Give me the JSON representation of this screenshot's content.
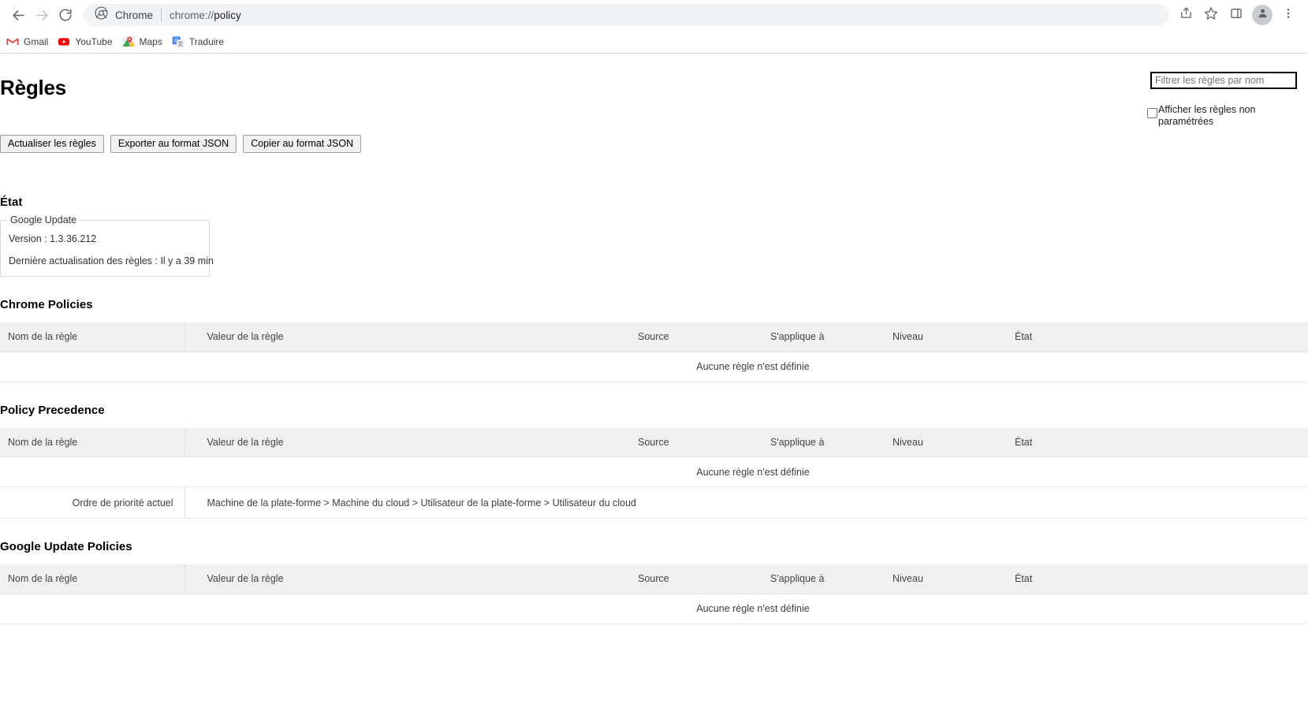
{
  "browser": {
    "back_icon": "back-arrow-icon",
    "forward_icon": "forward-arrow-icon",
    "reload_icon": "reload-icon",
    "omnibox": {
      "chrome_label": "Chrome",
      "url_scheme": "chrome://",
      "url_path": "policy"
    },
    "actions": {
      "share_icon": "share-icon",
      "bookmark_icon": "star-icon",
      "sidepanel_icon": "side-panel-icon",
      "profile_icon": "profile-avatar-icon",
      "menu_icon": "three-dot-menu-icon"
    },
    "bookmarks": [
      {
        "label": "Gmail",
        "icon": "gmail-icon"
      },
      {
        "label": "YouTube",
        "icon": "youtube-icon"
      },
      {
        "label": "Maps",
        "icon": "google-maps-icon"
      },
      {
        "label": "Traduire",
        "icon": "google-translate-icon"
      }
    ]
  },
  "page": {
    "title": "Règles",
    "filter": {
      "placeholder": "Filtrer les règles par nom",
      "value": ""
    },
    "show_unset": {
      "label": "Afficher les règles non paramétrées",
      "checked": false
    },
    "buttons": {
      "reload": "Actualiser les règles",
      "export": "Exporter au format JSON",
      "copy": "Copier au format JSON"
    },
    "status": {
      "heading": "État",
      "legend": "Google Update",
      "version_line": "Version : 1.3.36.212",
      "refresh_line": "Dernière actualisation des règles : Il y a 39 min"
    },
    "table_headers": {
      "name": "Nom de la règle",
      "value": "Valeur de la règle",
      "source": "Source",
      "applies_to": "S'applique à",
      "level": "Niveau",
      "status": "État"
    },
    "empty_text": "Aucune règle n'est définie",
    "sections": [
      {
        "heading": "Chrome Policies"
      },
      {
        "heading": "Policy Precedence"
      },
      {
        "heading": "Google Update Policies"
      }
    ],
    "precedence": {
      "name": "Ordre de priorité actuel",
      "value": "Machine de la plate-forme > Machine du cloud > Utilisateur de la plate-forme > Utilisateur du cloud"
    }
  }
}
